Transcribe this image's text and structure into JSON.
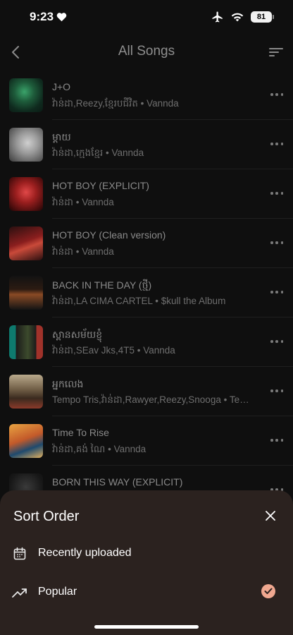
{
  "status": {
    "time": "9:23",
    "battery": "81"
  },
  "nav": {
    "title": "All Songs"
  },
  "songs": [
    {
      "title": "J+O",
      "subtitle": "វ៉ាន់ដា,Reezy,ខ្មែរបជីវិត • Vannda",
      "art": "art-green"
    },
    {
      "title": "ម្ដាយ",
      "subtitle": "វ៉ាន់ដា,ក្មេងខ្មែរ • Vannda",
      "art": "art-gray"
    },
    {
      "title": "HOT BOY (EXPLICIT)",
      "subtitle": "វ៉ាន់ដា • Vannda",
      "art": "art-red"
    },
    {
      "title": "HOT BOY (Clean version)",
      "subtitle": "វ៉ាន់ដា • Vannda",
      "art": "art-red2"
    },
    {
      "title": "BACK IN THE DAY (ថ្មី)",
      "subtitle": "វ៉ាន់ដា,LA CIMA CARTEL • $kull the Album",
      "art": "art-dark"
    },
    {
      "title": "ស្ពានសម័យខ្ញុំ",
      "subtitle": "វ៉ាន់ដា,SEav Jks,4T5 • Vannda",
      "art": "art-teal"
    },
    {
      "title": "អ្នកលេង",
      "subtitle": "Tempo Tris,វ៉ាន់ដា,Rawyer,Reezy,Snooga • Tempo Tris",
      "art": "art-sepia"
    },
    {
      "title": "Time To Rise",
      "subtitle": "វ៉ាន់ដា,គង់ ណៃ • Vannda",
      "art": "art-orange"
    },
    {
      "title": "BORN THIS WAY (EXPLICIT)",
      "subtitle": "",
      "art": "art-black"
    }
  ],
  "sheet": {
    "title": "Sort Order",
    "options": [
      {
        "label": "Recently uploaded",
        "icon": "calendar-icon",
        "selected": false
      },
      {
        "label": "Popular",
        "icon": "trending-up-icon",
        "selected": true
      }
    ]
  },
  "colors": {
    "accent": "#f0a890",
    "sheet_bg": "#2b221f",
    "background": "#0f0f0f"
  }
}
